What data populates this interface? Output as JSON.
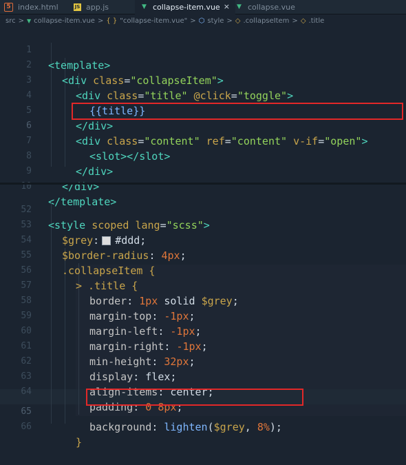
{
  "tabs": [
    {
      "name": "index.html",
      "icon": "html5-icon",
      "icon_glyph": "5",
      "icon_color": "#e06d3a"
    },
    {
      "name": "app.js",
      "icon": "js-icon",
      "icon_glyph": "JS",
      "icon_color": "#e2c541"
    },
    {
      "name": "collapse-item.vue",
      "icon": "vue-icon",
      "icon_glyph": "V",
      "icon_color": "#42b883",
      "close": "×"
    },
    {
      "name": "collapse.vue",
      "icon": "vue-icon",
      "icon_glyph": "V",
      "icon_color": "#42b883"
    }
  ],
  "breadcrumb": [
    "src",
    ">",
    "collapse-item.vue",
    ">",
    "{ }",
    "\"collapse-item.vue\"",
    ">",
    "style",
    ">",
    ".collapseItem",
    ">",
    ".title"
  ],
  "top_lines": [
    {
      "num": "1",
      "code": "<template>"
    },
    {
      "num": "2",
      "code": "<div class=\"collapseItem\">"
    },
    {
      "num": "3",
      "code": "<div class=\"title\" @click=\"toggle\">"
    },
    {
      "num": "4",
      "code": "{{title}}"
    },
    {
      "num": "5",
      "code": "</div>"
    },
    {
      "num": "6",
      "code": "<div class=\"content\" ref=\"content\" v-if=\"open\">"
    },
    {
      "num": "7",
      "code": "<slot></slot>"
    },
    {
      "num": "8",
      "code": "</div>"
    },
    {
      "num": "9",
      "code": "</div>"
    },
    {
      "num": "10",
      "code": "</template>"
    }
  ],
  "bottom_lines": [
    {
      "num": "52",
      "code": "<style scoped lang=\"scss\">"
    },
    {
      "num": "53",
      "code": "$grey: #ddd;"
    },
    {
      "num": "54",
      "code": "$border-radius: 4px;"
    },
    {
      "num": "55",
      "code": ".collapseItem {"
    },
    {
      "num": "56",
      "code": "> .title {"
    },
    {
      "num": "57",
      "code": "border: 1px solid $grey;"
    },
    {
      "num": "58",
      "code": "margin-top: -1px;"
    },
    {
      "num": "59",
      "code": "margin-left: -1px;"
    },
    {
      "num": "60",
      "code": "margin-right: -1px;"
    },
    {
      "num": "61",
      "code": "min-height: 32px;"
    },
    {
      "num": "62",
      "code": "display: flex;"
    },
    {
      "num": "63",
      "code": "align-items: center;"
    },
    {
      "num": "64",
      "code": "padding: 0 8px;"
    },
    {
      "num": "65",
      "code": "background: lighten($grey, 8%);"
    },
    {
      "num": "66",
      "code": "}"
    }
  ],
  "colors": {
    "highlight": "#e22828",
    "tag": "#4fd6be",
    "attr": "#c9a54b",
    "string": "#93d35b",
    "number": "#e0763a",
    "function": "#7fb7ff"
  }
}
